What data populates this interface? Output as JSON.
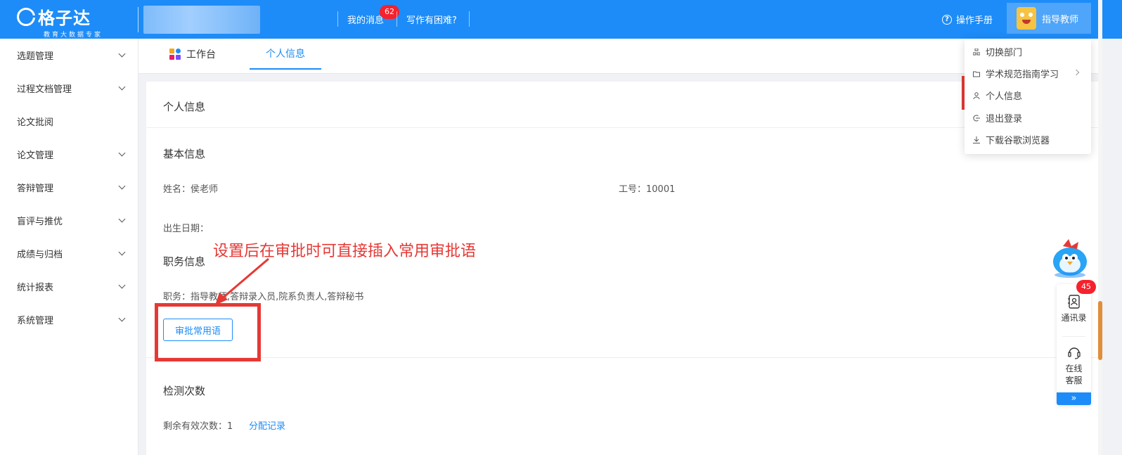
{
  "header": {
    "brand_text": "格子达",
    "brand_tagline": "教育大数据专家",
    "nav": {
      "messages": "我的消息",
      "messages_count": "62",
      "writing_help": "写作有困难?"
    },
    "manual": "操作手册",
    "user_role": "指导教师"
  },
  "sidebar": {
    "items": [
      {
        "label": "选题管理",
        "expandable": true
      },
      {
        "label": "过程文档管理",
        "expandable": true
      },
      {
        "label": "论文批阅",
        "expandable": false
      },
      {
        "label": "论文管理",
        "expandable": true
      },
      {
        "label": "答辩管理",
        "expandable": true
      },
      {
        "label": "盲评与推优",
        "expandable": true
      },
      {
        "label": "成绩与归档",
        "expandable": true
      },
      {
        "label": "统计报表",
        "expandable": true
      },
      {
        "label": "系统管理",
        "expandable": true
      }
    ]
  },
  "tabs": {
    "workbench": "工作台",
    "personal_info": "个人信息"
  },
  "card": {
    "title": "个人信息",
    "basic_title": "基本信息",
    "name_label": "姓名：",
    "name_value": "侯老师",
    "id_label": "工号：",
    "id_value": "10001",
    "birth_label": "出生日期：",
    "duty_title": "职务信息",
    "duty_label": "职务：",
    "duty_value": "指导教师,答辩录入员,院系负责人,答辩秘书",
    "approve_button": "审批常用语",
    "check_title": "检测次数",
    "remaining_label": "剩余有效次数：",
    "remaining_value": "1",
    "assign_link": "分配记录"
  },
  "annotation": {
    "text": "设置后在审批时可直接插入常用审批语",
    "color": "#e53935"
  },
  "dropdown": {
    "items": [
      {
        "label": "切换部门",
        "icon": "org-icon"
      },
      {
        "label": "学术规范指南学习",
        "icon": "folder-icon",
        "has_submenu": true
      },
      {
        "label": "个人信息",
        "icon": "user-icon"
      },
      {
        "label": "退出登录",
        "icon": "logout-icon"
      },
      {
        "label": "下载谷歌浏览器",
        "icon": "download-icon"
      }
    ]
  },
  "float_panel": {
    "badge": "45",
    "contacts": "通讯录",
    "service_line1": "在线",
    "service_line2": "客服",
    "expand": "»"
  },
  "colors": {
    "primary": "#1d8cf8",
    "badge_red": "#f5222d",
    "annotation_red": "#e53935"
  }
}
